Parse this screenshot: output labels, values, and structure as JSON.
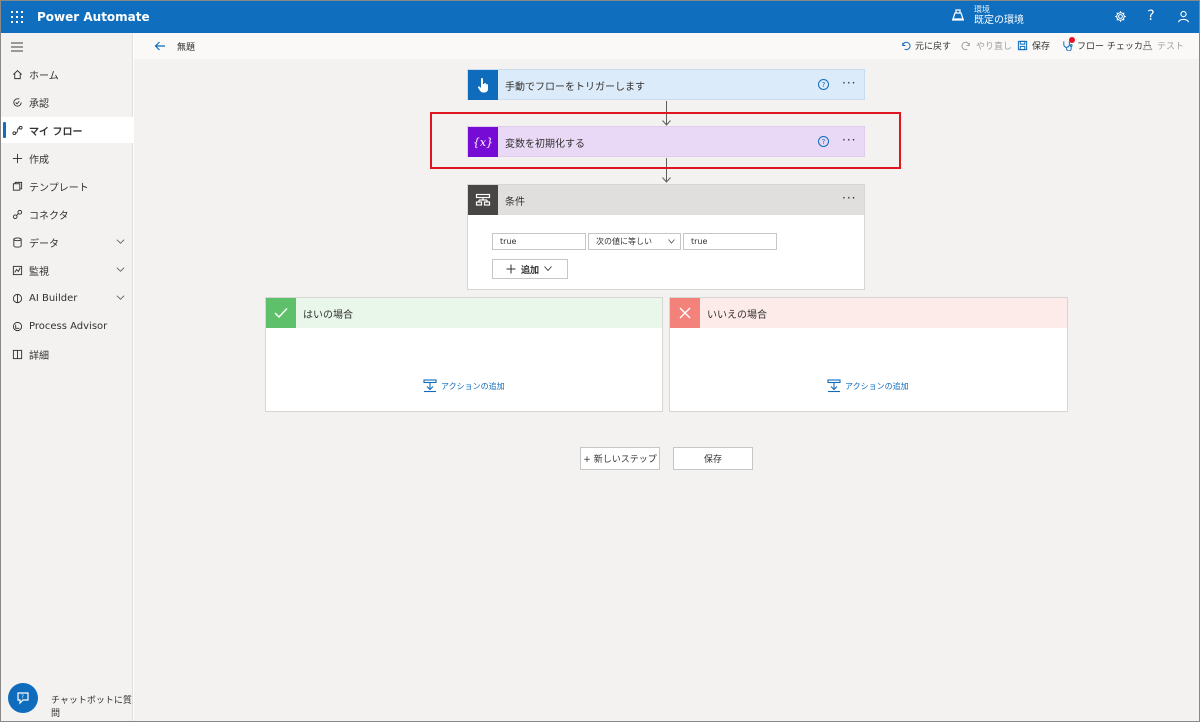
{
  "app": {
    "title": "Power Automate"
  },
  "environment": {
    "label": "環境",
    "name": "既定の環境"
  },
  "topbar": {
    "settings_icon": "gear-icon",
    "help_label": "?",
    "account_icon": "person-icon"
  },
  "sidebar": {
    "items": [
      {
        "label": "ホーム",
        "icon": "home-icon"
      },
      {
        "label": "承認",
        "icon": "approval-icon"
      },
      {
        "label": "マイ フロー",
        "icon": "flow-icon",
        "active": true
      },
      {
        "label": "作成",
        "icon": "plus-icon"
      },
      {
        "label": "テンプレート",
        "icon": "template-icon"
      },
      {
        "label": "コネクタ",
        "icon": "connector-icon"
      },
      {
        "label": "データ",
        "icon": "database-icon",
        "expandable": true
      },
      {
        "label": "監視",
        "icon": "monitor-icon",
        "expandable": true
      },
      {
        "label": "AI Builder",
        "icon": "ai-builder-icon",
        "expandable": true
      },
      {
        "label": "Process Advisor",
        "icon": "process-advisor-icon"
      },
      {
        "label": "詳細",
        "icon": "book-icon"
      }
    ],
    "chatbot_label": "チャットボットに質問"
  },
  "commandbar": {
    "flow_name": "無題",
    "undo": "元に戻す",
    "redo": "やり直し",
    "save": "保存",
    "flow_checker": "フロー チェッカー",
    "test": "テスト"
  },
  "flow": {
    "trigger": {
      "title": "手動でフローをトリガーします",
      "help": "?",
      "more": "···",
      "color": "#0f6cbd"
    },
    "init_variable": {
      "title": "変数を初期化する",
      "help": "?",
      "more": "···",
      "color": "#770bd6",
      "icon_text": "{x}"
    },
    "condition": {
      "title": "条件",
      "more": "···",
      "left_value": "true",
      "operator": "次の値に等しい",
      "right_value": "true",
      "add_label": "追加"
    },
    "yes_branch": {
      "title": "はいの場合",
      "add_action": "アクションの追加",
      "color": "#5fc06b"
    },
    "no_branch": {
      "title": "いいえの場合",
      "add_action": "アクションの追加",
      "color": "#f3837a"
    }
  },
  "footer": {
    "new_step": "+ 新しいステップ",
    "save": "保存"
  }
}
